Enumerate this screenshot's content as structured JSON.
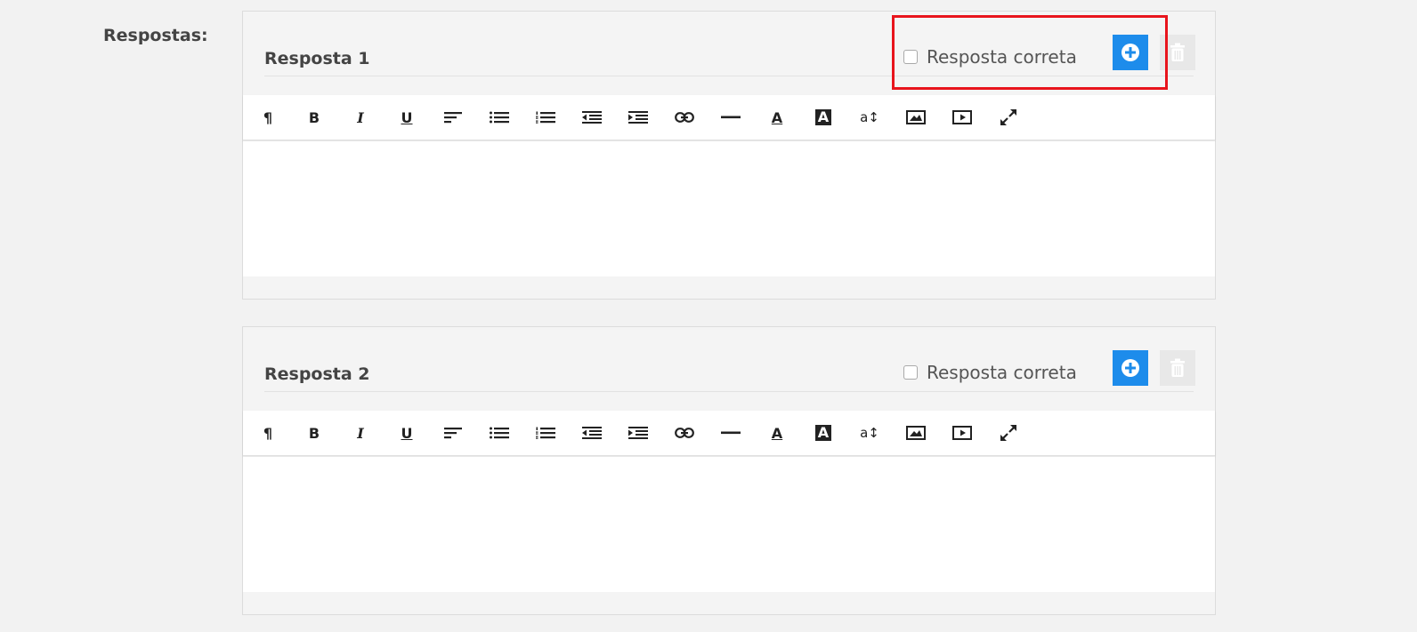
{
  "form": {
    "field_label": "Respostas:"
  },
  "answers": [
    {
      "title": "Resposta 1",
      "correct_label": "Resposta correta",
      "correct_checked": false
    },
    {
      "title": "Resposta 2",
      "correct_label": "Resposta correta",
      "correct_checked": false
    }
  ],
  "toolbar": {
    "paragraph": "¶",
    "bold": "B",
    "italic": "I",
    "underline": "U",
    "font_color": "A",
    "background_color": "A",
    "font_size": "a↕"
  },
  "colors": {
    "accent": "#1d8ceb",
    "highlight": "#e8141c"
  }
}
